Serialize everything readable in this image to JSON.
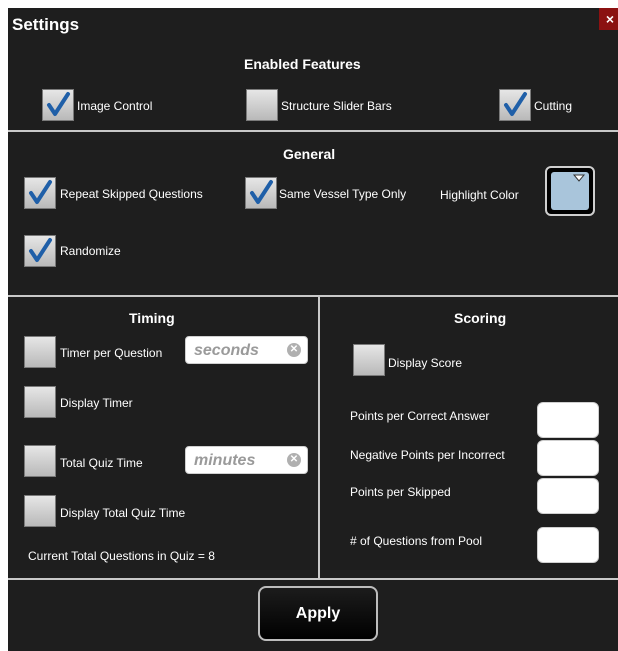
{
  "window": {
    "title": "Settings",
    "close_symbol": "×"
  },
  "enabled_features": {
    "title": "Enabled Features",
    "items": [
      {
        "label": "Image Control",
        "checked": true
      },
      {
        "label": "Structure Slider Bars",
        "checked": false
      },
      {
        "label": "Cutting",
        "checked": true
      }
    ]
  },
  "general": {
    "title": "General",
    "items": [
      {
        "label": "Repeat Skipped Questions",
        "checked": true
      },
      {
        "label": "Same Vessel Type Only",
        "checked": true
      },
      {
        "label": "Randomize",
        "checked": true
      }
    ],
    "highlight_label": "Highlight Color",
    "highlight_color": "#a9c5db"
  },
  "timing": {
    "title": "Timing",
    "timer_per_question": {
      "label": "Timer per Question",
      "checked": false,
      "placeholder": "seconds",
      "value": ""
    },
    "display_timer": {
      "label": "Display Timer",
      "checked": false
    },
    "total_quiz_time": {
      "label": "Total Quiz Time",
      "checked": false,
      "placeholder": "minutes",
      "value": ""
    },
    "display_total_quiz_time": {
      "label": "Display Total Quiz Time",
      "checked": false
    },
    "current_total": "Current Total Questions in Quiz = 8"
  },
  "scoring": {
    "title": "Scoring",
    "display_score": {
      "label": "Display Score",
      "checked": false
    },
    "fields": [
      {
        "label": "Points per Correct Answer",
        "value": ""
      },
      {
        "label": "Negative Points per Incorrect",
        "value": ""
      },
      {
        "label": "Points per Skipped",
        "value": ""
      },
      {
        "label": "# of Questions from Pool",
        "value": ""
      }
    ]
  },
  "apply_label": "Apply",
  "colors": {
    "panel": "#1e1e1e",
    "divider": "#c9c9c9",
    "check": "#1f5fa8",
    "close": "#8b1111"
  }
}
